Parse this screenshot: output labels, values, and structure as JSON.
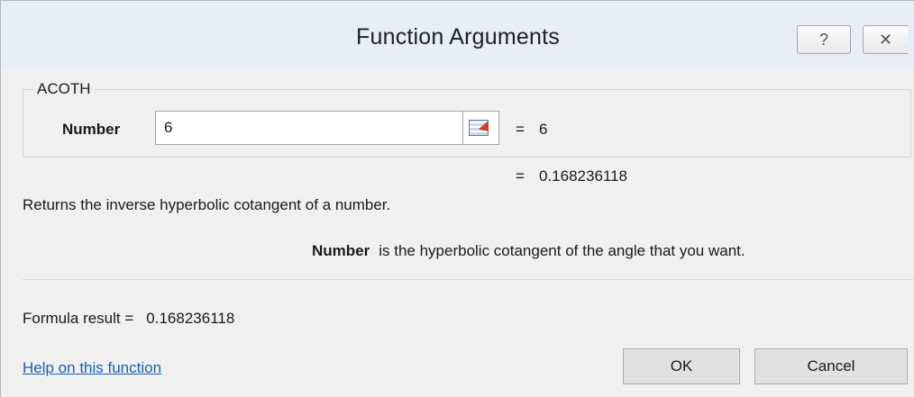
{
  "window": {
    "title": "Function Arguments",
    "help_glyph": "?",
    "close_glyph": "✕"
  },
  "group": {
    "function_name": "ACOTH",
    "argument": {
      "label": "Number",
      "input_value": "6",
      "equals": "=",
      "evaluated": "6"
    }
  },
  "result_line": {
    "equals": "=",
    "value": "0.168236118"
  },
  "description": "Returns the inverse hyperbolic cotangent of a number.",
  "argument_help": {
    "name": "Number",
    "text": "is the hyperbolic cotangent of the angle that you want."
  },
  "formula_result": {
    "label": "Formula result =",
    "value": "0.168236118"
  },
  "footer": {
    "help_link": "Help on this function",
    "ok_label": "OK",
    "cancel_label": "Cancel"
  }
}
